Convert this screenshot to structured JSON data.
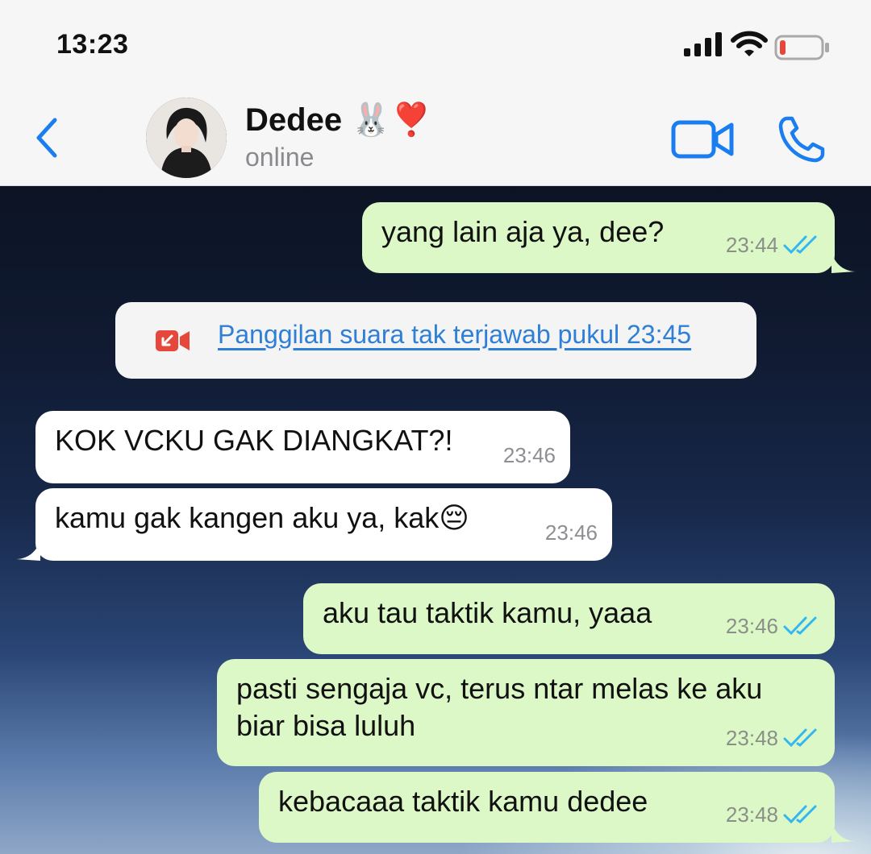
{
  "status_bar": {
    "time": "13:23",
    "signal_icon": "cellular-signal-icon",
    "wifi_icon": "wifi-icon",
    "battery_icon": "battery-low-icon",
    "battery_level_fraction": 0.12
  },
  "header": {
    "back_icon": "chevron-left-icon",
    "contact_name": "Dedee 🐰❣️",
    "contact_status": "online",
    "video_icon": "video-camera-icon",
    "call_icon": "phone-icon"
  },
  "messages": [
    {
      "direction": "out",
      "text": "yang lain aja ya, dee?",
      "time": "23:44",
      "read": true
    },
    {
      "direction": "system",
      "text": "Panggilan suara tak terjawab pukul 23:45",
      "icon": "missed-video-call-icon"
    },
    {
      "direction": "in",
      "text": "KOK VCKU GAK DIANGKAT?!",
      "time": "23:46"
    },
    {
      "direction": "in",
      "text": "kamu gak kangen aku ya, kak😔",
      "time": "23:46"
    },
    {
      "direction": "out",
      "text": "aku tau taktik kamu, yaaa",
      "time": "23:46",
      "read": true
    },
    {
      "direction": "out",
      "text": "pasti sengaja vc, terus ntar melas ke aku\nbiar bisa luluh",
      "time": "23:48",
      "read": true
    },
    {
      "direction": "out",
      "text": "kebacaaa taktik kamu dedee",
      "time": "23:48",
      "read": true
    }
  ],
  "colors": {
    "accent": "#1a7ef0",
    "outgoing_bubble": "#dcf8c6",
    "incoming_bubble": "#ffffff",
    "read_ticks": "#34b7f1",
    "missed_call": "#e5483b"
  }
}
